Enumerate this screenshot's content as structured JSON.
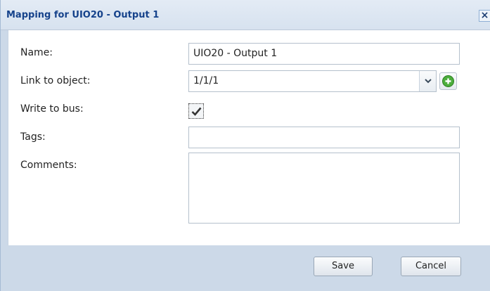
{
  "dialog": {
    "title": "Mapping for UIO20 - Output 1",
    "close_glyph": "×"
  },
  "form": {
    "name_label": "Name:",
    "name_value": "UIO20 - Output 1",
    "link_label": "Link to object:",
    "link_value": "1/1/1",
    "write_label": "Write to bus:",
    "write_checked": true,
    "tags_label": "Tags:",
    "tags_value": "",
    "comments_label": "Comments:",
    "comments_value": ""
  },
  "buttons": {
    "save_label": "Save",
    "cancel_label": "Cancel"
  },
  "icons": {
    "close": "close-icon",
    "dropdown": "chevron-down-icon",
    "add": "add-icon",
    "check": "check-icon"
  },
  "colors": {
    "title_text": "#15428b",
    "dialog_background": "#ccd9e8",
    "add_icon": "#4cae3c"
  }
}
